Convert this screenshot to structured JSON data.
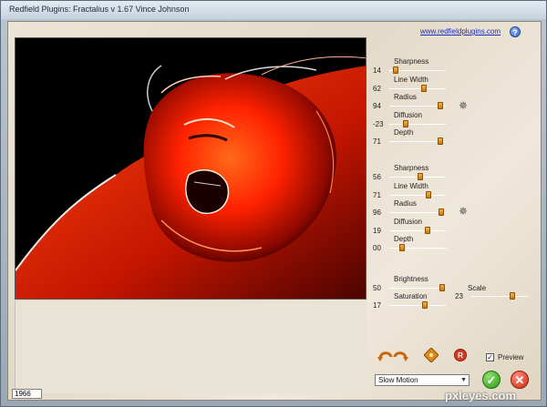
{
  "window": {
    "title": "Redfield Plugins: Fractalius v 1.67    Vince Johnson"
  },
  "header": {
    "link_text": "www.redfieldplugins.com",
    "help_glyph": "?"
  },
  "status": {
    "value": "1966"
  },
  "group1": [
    {
      "label": "Sharpness",
      "value": "14",
      "level": 0.08
    },
    {
      "label": "Line Width",
      "value": "62",
      "level": 0.62
    },
    {
      "label": "Radius",
      "value": "94",
      "level": 0.94
    },
    {
      "label": "Diffusion",
      "value": "-23",
      "level": 0.26
    },
    {
      "label": "Depth",
      "value": "71",
      "level": 0.95
    }
  ],
  "group2": [
    {
      "label": "Sharpness",
      "value": "56",
      "level": 0.56
    },
    {
      "label": "Line Width",
      "value": "71",
      "level": 0.71
    },
    {
      "label": "Radius",
      "value": "96",
      "level": 0.96
    },
    {
      "label": "Diffusion",
      "value": "19",
      "level": 0.69
    },
    {
      "label": "Depth",
      "value": "00",
      "level": 0.2
    }
  ],
  "group3": [
    {
      "label": "Brightness",
      "value": "50",
      "level": 0.98
    },
    {
      "label": "Saturation",
      "value": "17",
      "level": 0.65
    }
  ],
  "scale": {
    "label": "Scale",
    "value": "23",
    "level": 0.75
  },
  "gear_glyph": "✵",
  "preview_checkbox": {
    "label": "Preview",
    "checked": true,
    "mark": "✓"
  },
  "mode_dropdown": {
    "selected": "Slow Motion",
    "arrow": "▼"
  },
  "buttons": {
    "ok_glyph": "✓",
    "cancel_glyph": "✕"
  },
  "watermark": "pxleyes.com",
  "colors": {
    "thumb": "#e59a2a",
    "ok": "#35a51b",
    "cancel": "#d8341b",
    "accent_red": "#ff2a0a"
  }
}
